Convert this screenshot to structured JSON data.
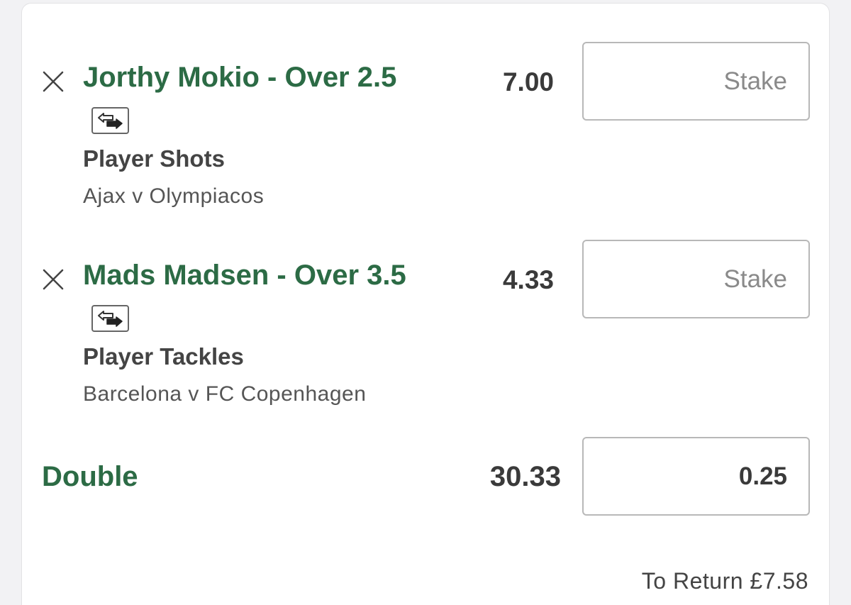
{
  "selections": [
    {
      "name": "Jorthy Mokio - Over 2.5",
      "odds": "7.00",
      "market": "Player Shots",
      "event": "Ajax v Olympiacos",
      "stake_placeholder": "Stake",
      "stake_value": ""
    },
    {
      "name": "Mads Madsen - Over 3.5",
      "odds": "4.33",
      "market": "Player Tackles",
      "event": "Barcelona v FC Copenhagen",
      "stake_placeholder": "Stake",
      "stake_value": ""
    }
  ],
  "double": {
    "label": "Double",
    "odds": "30.33",
    "stake_value": "0.25"
  },
  "summary": {
    "to_return": "To Return £7.58"
  },
  "icons": {
    "remove": "close-icon",
    "swap": "swap-icon"
  },
  "colors": {
    "accent_green": "#2c6b45",
    "text_dark": "#3a3a3a",
    "border": "#b8b8b8"
  }
}
